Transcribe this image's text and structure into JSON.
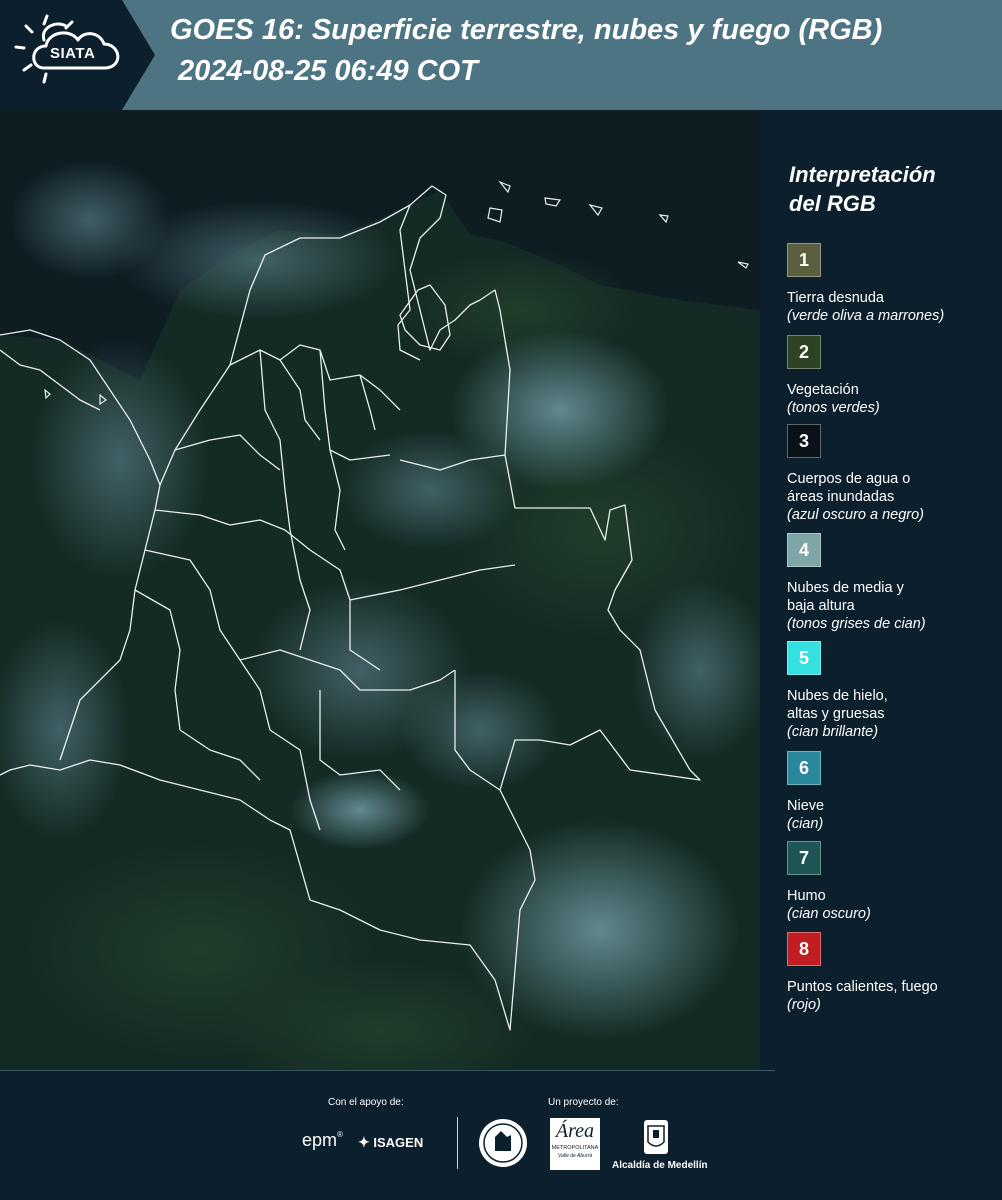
{
  "header": {
    "logo_text": "SIATA",
    "title": "GOES 16: Superficie terrestre, nubes y fuego (RGB)",
    "datetime": "2024-08-25 06:49 COT"
  },
  "legend": {
    "title_line1": "Interpretación",
    "title_line2": "del RGB",
    "items": [
      {
        "num": "1",
        "label": "Tierra desnuda",
        "sub": "(verde oliva a marrones)",
        "color": "#5b5e3f"
      },
      {
        "num": "2",
        "label": "Vegetación",
        "sub": "(tonos verdes)",
        "color": "#2c4324"
      },
      {
        "num": "3",
        "label": "Cuerpos de agua o\náreas inundadas",
        "sub": "(azul oscuro a negro)",
        "color": "#0a1218"
      },
      {
        "num": "4",
        "label": "Nubes de media y\nbaja altura",
        "sub": "(tonos grises de cian)",
        "color": "#7fa6a6"
      },
      {
        "num": "5",
        "label": "Nubes de hielo,\naltas y gruesas",
        "sub": "(cian brillante)",
        "color": "#35e0e0"
      },
      {
        "num": "6",
        "label": "Nieve",
        "sub": "(cian)",
        "color": "#2a889c"
      },
      {
        "num": "7",
        "label": "Humo",
        "sub": "(cian oscuro)",
        "color": "#1e5656"
      },
      {
        "num": "8",
        "label": "Puntos calientes, fuego",
        "sub": "(rojo)",
        "color": "#c11e23"
      }
    ]
  },
  "footer": {
    "support_caption": "Con el apoyo de:",
    "project_caption": "Un proyecto de:",
    "sponsor_epm": "epm",
    "sponsor_isagen": "ISAGEN",
    "sponsor_area": "Área",
    "sponsor_area_sub": "METROPOLITANA",
    "sponsor_area_sub2": "Valle de Aburrá",
    "sponsor_alcaldia": "Alcaldía de Medellín"
  }
}
